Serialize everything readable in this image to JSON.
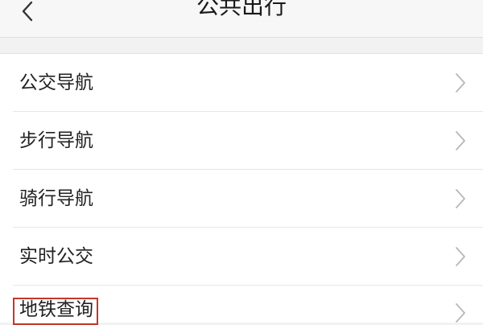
{
  "header": {
    "title": "公共出行",
    "back_icon": "chevron-left-icon"
  },
  "menu": {
    "items": [
      {
        "label": "公交导航",
        "icon": "chevron-right-icon"
      },
      {
        "label": "步行导航",
        "icon": "chevron-right-icon"
      },
      {
        "label": "骑行导航",
        "icon": "chevron-right-icon"
      },
      {
        "label": "实时公交",
        "icon": "chevron-right-icon"
      },
      {
        "label": "地铁查询",
        "icon": "chevron-right-icon",
        "highlighted": true
      }
    ]
  },
  "colors": {
    "background": "#f2f2f2",
    "nav_bar": "#f7f7f7",
    "list_background": "#ffffff",
    "text": "#222222",
    "chevron": "#b8b8b8",
    "highlight_border": "#c0392b"
  }
}
